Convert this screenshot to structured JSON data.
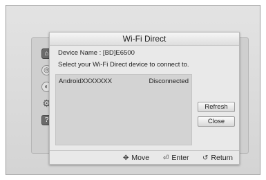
{
  "dialog": {
    "title": "Wi-Fi Direct",
    "device_name": "Device Name : [BD]E6500",
    "instruction": "Select your Wi-Fi Direct device to connect to."
  },
  "devices": [
    {
      "name": "AndroidXXXXXXX",
      "status": "Disconnected"
    }
  ],
  "buttons": {
    "refresh": "Refresh",
    "close": "Close"
  },
  "footer": {
    "move": "Move",
    "enter": "Enter",
    "return": "Return"
  },
  "icons": {
    "move": "four-way-arrow-icon",
    "enter": "enter-icon",
    "return": "return-arrow-icon"
  }
}
